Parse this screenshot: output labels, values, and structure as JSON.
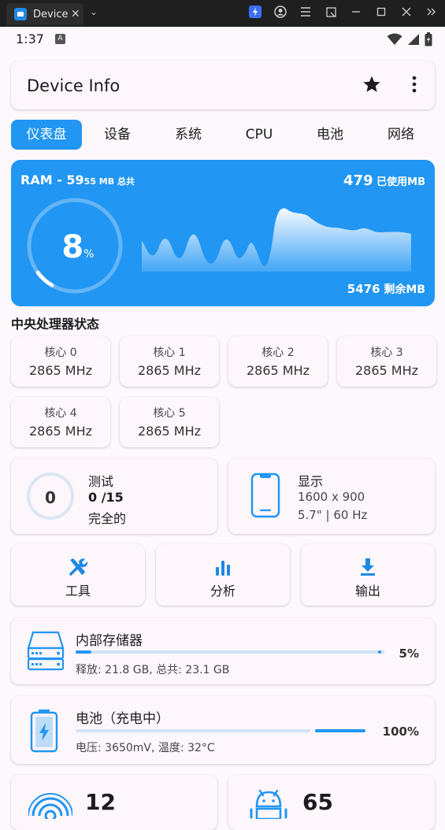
{
  "browser": {
    "tab_title": "Device...",
    "close": "✕"
  },
  "status": {
    "time": "1:37",
    "notification_letter": "A"
  },
  "appbar": {
    "title": "Device Info"
  },
  "tabs": [
    {
      "label": "仪表盘",
      "active": true
    },
    {
      "label": "设备",
      "active": false
    },
    {
      "label": "系统",
      "active": false
    },
    {
      "label": "CPU",
      "active": false
    },
    {
      "label": "电池",
      "active": false
    },
    {
      "label": "网络",
      "active": false
    }
  ],
  "ram": {
    "title_prefix": "RAM - 59",
    "title_suffix": "55 MB 总共",
    "used_value": "479",
    "used_unit": " 已使用MB",
    "free_value": "5476",
    "free_unit": " 剩余MB",
    "percent": "8",
    "percent_unit": "%",
    "usage_fraction": 0.08,
    "accent_color": "#2196f3"
  },
  "cpu": {
    "section_title": "中央处理器状态",
    "cores": [
      {
        "name": "核心 0",
        "freq": "2865 MHz"
      },
      {
        "name": "核心 1",
        "freq": "2865 MHz"
      },
      {
        "name": "核心 2",
        "freq": "2865 MHz"
      },
      {
        "name": "核心 3",
        "freq": "2865 MHz"
      },
      {
        "name": "核心 4",
        "freq": "2865 MHz"
      },
      {
        "name": "核心 5",
        "freq": "2865 MHz"
      }
    ]
  },
  "test": {
    "count": "0",
    "label": "测试",
    "progress": "0 /15",
    "status": "完全的",
    "progress_fraction": 0
  },
  "display": {
    "label": "显示",
    "resolution": "1600 x 900",
    "size_refresh": "5.7\" | 60 Hz"
  },
  "actions": [
    {
      "label": "工具",
      "icon": "tools-icon"
    },
    {
      "label": "分析",
      "icon": "bar-chart-icon"
    },
    {
      "label": "输出",
      "icon": "download-icon"
    }
  ],
  "storage": {
    "title": "内部存储器",
    "subtitle": "释放: 21.8 GB,  总共: 23.1 GB",
    "percent": "5%",
    "used_fraction": 0.05
  },
  "battery": {
    "title": "电池（充电中）",
    "subtitle": "电压: 3650mV,  温度: 32°C",
    "percent": "100%",
    "level_fraction": 1.0
  },
  "bottom": {
    "sensors_count": "12",
    "apps_count": "65"
  }
}
